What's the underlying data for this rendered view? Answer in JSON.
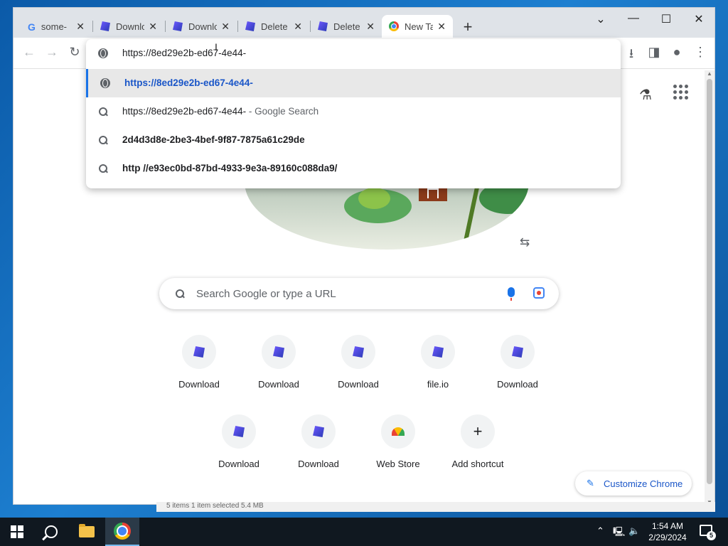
{
  "tabs": [
    {
      "title": "some-",
      "favicon": "google-g-icon",
      "glyph": "G"
    },
    {
      "title": "Downlo",
      "favicon": "fileio-icon"
    },
    {
      "title": "Downlo",
      "favicon": "fileio-icon"
    },
    {
      "title": "Delete",
      "favicon": "fileio-icon"
    },
    {
      "title": "Delete",
      "favicon": "fileio-icon"
    },
    {
      "title": "New Ta",
      "favicon": "chrome-icon",
      "active": true
    }
  ],
  "tab_close_glyph": "✕",
  "new_tab_glyph": "+",
  "window_controls": {
    "dropdown": "⌄",
    "minimize": "—",
    "maximize": "☐",
    "close": "✕"
  },
  "toolbar": {
    "back": "←",
    "forward": "→",
    "reload": "↻",
    "download": "⭳",
    "sidepanel": "◨",
    "profile": "●",
    "menu": "⋮"
  },
  "omnibox": {
    "input_value": "https://8ed29e2b-ed67-4e44-",
    "suggestions": [
      {
        "icon": "globe-icon",
        "text": "https://8ed29e2b-ed67-4e44-",
        "suffix": "",
        "style": "url-selected"
      },
      {
        "icon": "search-icon",
        "text": "https://8ed29e2b-ed67-4e44-",
        "suffix": " - Google Search",
        "style": "plain"
      },
      {
        "icon": "search-icon",
        "text": "2d4d3d8e-2be3-4bef-9f87-7875a61c29de",
        "suffix": "",
        "style": "bold"
      },
      {
        "icon": "search-icon",
        "text": "http //e93ec0bd-87bd-4933-9e3a-89160c088da9/",
        "suffix": "",
        "style": "bold"
      }
    ]
  },
  "ntp": {
    "search_placeholder": "Search Google or type a URL",
    "labs_glyph": "⚗",
    "share_glyph": "⇆",
    "shortcuts": [
      {
        "label": "Download",
        "icon": "fileio-icon"
      },
      {
        "label": "Download",
        "icon": "fileio-icon"
      },
      {
        "label": "Download",
        "icon": "fileio-icon"
      },
      {
        "label": "file.io",
        "icon": "fileio-icon"
      },
      {
        "label": "Download",
        "icon": "fileio-icon"
      },
      {
        "label": "Download",
        "icon": "fileio-icon"
      },
      {
        "label": "Download",
        "icon": "fileio-icon"
      },
      {
        "label": "Web Store",
        "icon": "web-store-icon"
      },
      {
        "label": "Add shortcut",
        "icon": "plus-icon",
        "glyph": "+"
      }
    ],
    "customize_label": "Customize Chrome",
    "customize_glyph": "✎"
  },
  "explorer_strip": {
    "text": "5 items     1 item selected  5.4 MB"
  },
  "taskbar": {
    "time": "1:54 AM",
    "date": "2/29/2024",
    "tray_chevron": "⌃",
    "notification_count": "5"
  }
}
